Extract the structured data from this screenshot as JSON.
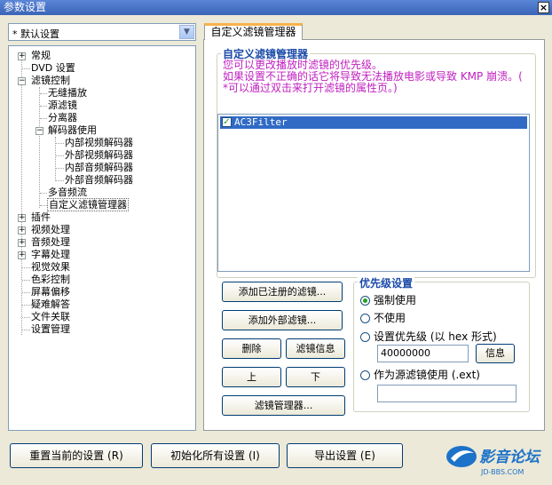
{
  "window": {
    "title": "参数设置",
    "close_glyph": "×"
  },
  "preset": {
    "value": "* 默认设置",
    "arrow": "▼"
  },
  "tree": {
    "nodes": [
      {
        "label": "常规",
        "toggle": "+"
      },
      {
        "label": "DVD 设置"
      },
      {
        "label": "滤镜控制",
        "toggle": "−"
      },
      {
        "label": "无缝播放"
      },
      {
        "label": "源滤镜"
      },
      {
        "label": "分离器"
      },
      {
        "label": "解码器使用",
        "toggle": "−"
      },
      {
        "label": "内部视频解码器"
      },
      {
        "label": "外部视频解码器"
      },
      {
        "label": "内部音频解码器"
      },
      {
        "label": "外部音频解码器"
      },
      {
        "label": "多音频流"
      },
      {
        "label": "自定义滤镜管理器"
      },
      {
        "label": "插件",
        "toggle": "+"
      },
      {
        "label": "视频处理",
        "toggle": "+"
      },
      {
        "label": "音频处理",
        "toggle": "+"
      },
      {
        "label": "字幕处理",
        "toggle": "+"
      },
      {
        "label": "视觉效果"
      },
      {
        "label": "色彩控制"
      },
      {
        "label": "屏幕偏移"
      },
      {
        "label": "疑难解答"
      },
      {
        "label": "文件关联"
      },
      {
        "label": "设置管理"
      }
    ]
  },
  "tab": {
    "label": "自定义滤镜管理器"
  },
  "manager": {
    "group_title": "自定义滤镜管理器",
    "desc_line1": "您可以更改播放时滤镜的优先级。",
    "desc_line2": "如果设置不正确的话它将导致无法播放电影或导致 KMP 崩溃。(",
    "desc_line3": "*可以通过双击来打开滤镜的属性页。)",
    "filters": [
      {
        "name": "AC3Filter",
        "checked": true,
        "check_glyph": "✓"
      }
    ]
  },
  "buttons": {
    "add_registered": "添加已注册的滤镜...",
    "add_external": "添加外部滤镜...",
    "delete": "删除",
    "filter_info": "滤镜信息",
    "up": "上",
    "down": "下",
    "filter_manager": "滤镜管理器..."
  },
  "priority": {
    "group_title": "优先级设置",
    "force": "强制使用",
    "not_use": "不使用",
    "set_priority": "设置优先级 (以 hex 形式)",
    "value": "40000000",
    "info_button": "信息",
    "as_source": "作为源滤镜使用 (.ext)",
    "ext_value": ""
  },
  "footer": {
    "reset": "重置当前的设置 (R)",
    "init_all": "初始化所有设置 (I)",
    "export": "导出设置 (E)"
  },
  "logo": {
    "text": "影音论坛",
    "url_text": "JD-BBS.COM",
    "primary": "#1d72c9"
  }
}
